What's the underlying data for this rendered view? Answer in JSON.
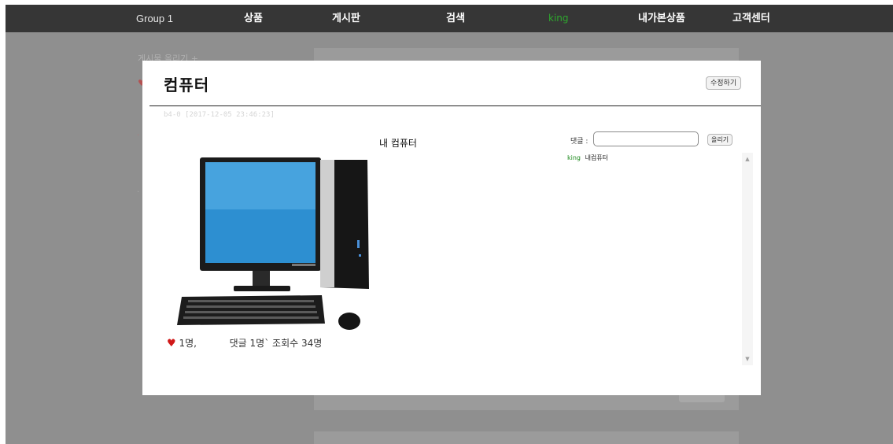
{
  "nav": {
    "brand": "Group 1",
    "products": "상품",
    "board": "게시판",
    "search": "검색",
    "user": "king",
    "my_products": "내가본상품",
    "support": "고객센터"
  },
  "background": {
    "write_link": "게시물 올리기 +",
    "heart": "♥"
  },
  "post": {
    "title": "컴퓨터",
    "edit_label": "수정하기",
    "meta": "b4-0 [2017-12-05 23:46:23]",
    "body": "내 컴퓨터",
    "image_icon": "desktop-computer"
  },
  "stats": {
    "heart_icon": "♥",
    "likes": "1명,",
    "comments": "댓글 1명`",
    "views": "조회수 34명"
  },
  "comments": {
    "label": "댓글 :",
    "input_value": "",
    "submit_label": "올리기",
    "items": [
      {
        "author": "king",
        "text": "내컴퓨터"
      }
    ]
  },
  "colors": {
    "overlay": "#8f8f8f",
    "nav_bg": "#363636",
    "user_green": "#2ea82e",
    "heart_red": "#d01818"
  }
}
